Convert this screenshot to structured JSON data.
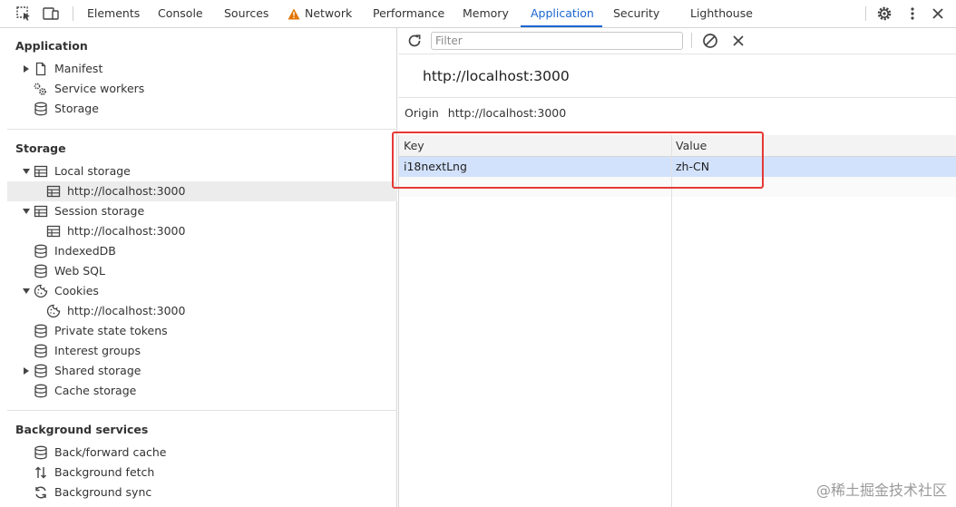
{
  "tabs": [
    {
      "label": "Elements"
    },
    {
      "label": "Console"
    },
    {
      "label": "Sources"
    },
    {
      "label": "Network"
    },
    {
      "label": "Performance"
    },
    {
      "label": "Memory"
    },
    {
      "label": "Application"
    },
    {
      "label": "Security"
    },
    {
      "label": "Lighthouse"
    }
  ],
  "active_tab": "Application",
  "colors": {
    "accent": "#1a66d2",
    "warning": "#e37400",
    "highlight": "#e53935",
    "row_selected": "#d3e2fc"
  },
  "sidebar": {
    "application": {
      "title": "Application",
      "items": [
        {
          "label": "Manifest",
          "icon": "file-icon"
        },
        {
          "label": "Service workers",
          "icon": "gears-icon"
        },
        {
          "label": "Storage",
          "icon": "database-icon"
        }
      ]
    },
    "storage": {
      "title": "Storage",
      "items": [
        {
          "label": "Local storage",
          "icon": "table-icon"
        },
        {
          "label": "http://localhost:3000",
          "icon": "table-icon"
        },
        {
          "label": "Session storage",
          "icon": "table-icon"
        },
        {
          "label": "http://localhost:3000",
          "icon": "table-icon"
        },
        {
          "label": "IndexedDB",
          "icon": "database-icon"
        },
        {
          "label": "Web SQL",
          "icon": "database-icon"
        },
        {
          "label": "Cookies",
          "icon": "cookie-icon"
        },
        {
          "label": "http://localhost:3000",
          "icon": "cookie-icon"
        },
        {
          "label": "Private state tokens",
          "icon": "database-icon"
        },
        {
          "label": "Interest groups",
          "icon": "database-icon"
        },
        {
          "label": "Shared storage",
          "icon": "database-icon"
        },
        {
          "label": "Cache storage",
          "icon": "database-icon"
        }
      ]
    },
    "background": {
      "title": "Background services",
      "items": [
        {
          "label": "Back/forward cache",
          "icon": "database-icon"
        },
        {
          "label": "Background fetch",
          "icon": "arrows-updown-icon"
        },
        {
          "label": "Background sync",
          "icon": "sync-icon"
        }
      ]
    }
  },
  "main": {
    "filter_placeholder": "Filter",
    "origin_title": "http://localhost:3000",
    "origin_label": "Origin",
    "origin_value": "http://localhost:3000",
    "columns": [
      "Key",
      "Value"
    ],
    "rows": [
      {
        "key": "i18nextLng",
        "value": "zh-CN"
      }
    ]
  },
  "watermark": "@稀土掘金技术社区"
}
